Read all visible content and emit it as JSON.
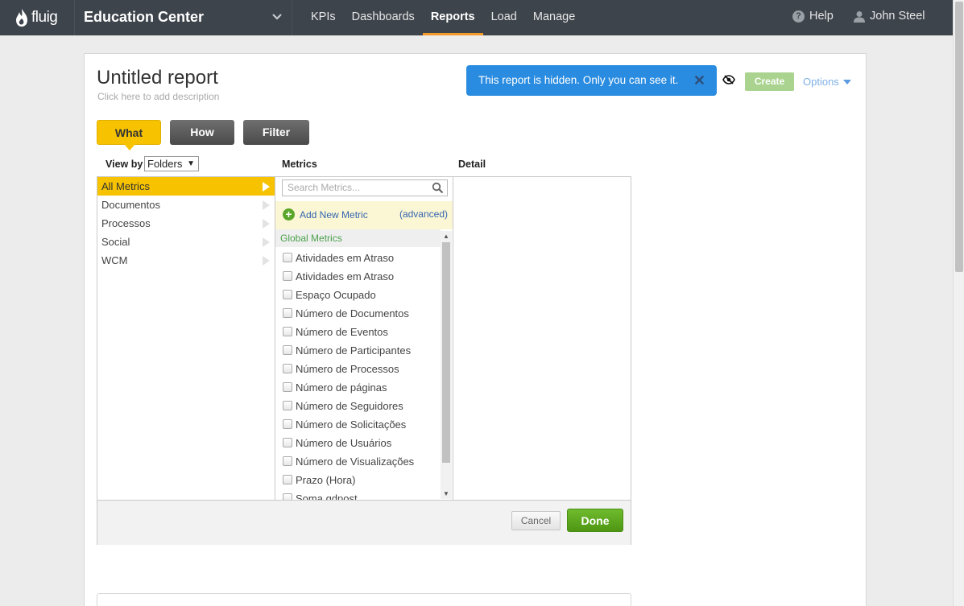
{
  "header": {
    "logo_text": "fluig",
    "app_title": "Education Center",
    "nav": [
      "KPIs",
      "Dashboards",
      "Reports",
      "Load",
      "Manage"
    ],
    "active_nav": "Reports",
    "help_label": "Help",
    "user_name": "John Steel"
  },
  "report": {
    "title": "Untitled report",
    "description": "Click here to add description",
    "hidden_message": "This report is hidden. Only you can see it.",
    "create_label": "Create",
    "options_label": "Options"
  },
  "tabs": {
    "what": "What",
    "how": "How",
    "filter": "Filter"
  },
  "columns": {
    "view_by_label": "View by",
    "view_by_value": "Folders",
    "metrics_label": "Metrics",
    "detail_label": "Detail"
  },
  "folders": [
    "All Metrics",
    "Documentos",
    "Processos",
    "Social",
    "WCM"
  ],
  "metrics": {
    "search_placeholder": "Search Metrics...",
    "add_new_label": "Add New Metric",
    "advanced_label": "(advanced)",
    "group_label": "Global Metrics",
    "items": [
      "Atividades em Atraso",
      "Atividades em Atraso",
      "Espaço Ocupado",
      "Número de Documentos",
      "Número de Eventos",
      "Número de Participantes",
      "Número de Processos",
      "Número de páginas",
      "Número de Seguidores",
      "Número de Solicitações",
      "Número de Usuários",
      "Número de Visualizações",
      "Prazo (Hora)",
      "Soma gdpost"
    ]
  },
  "footer": {
    "cancel_label": "Cancel",
    "done_label": "Done"
  },
  "colors": {
    "accent": "#f7c300",
    "nav_bg": "#3e444c",
    "info_blue": "#2a8ce0",
    "done_green": "#5ba81f"
  }
}
